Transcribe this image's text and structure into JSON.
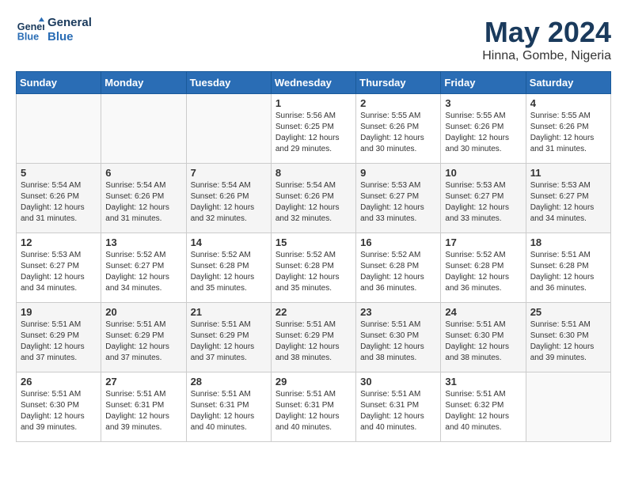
{
  "header": {
    "logo_line1": "General",
    "logo_line2": "Blue",
    "month": "May 2024",
    "location": "Hinna, Gombe, Nigeria"
  },
  "weekdays": [
    "Sunday",
    "Monday",
    "Tuesday",
    "Wednesday",
    "Thursday",
    "Friday",
    "Saturday"
  ],
  "weeks": [
    [
      {
        "day": "",
        "info": ""
      },
      {
        "day": "",
        "info": ""
      },
      {
        "day": "",
        "info": ""
      },
      {
        "day": "1",
        "info": "Sunrise: 5:56 AM\nSunset: 6:25 PM\nDaylight: 12 hours and 29 minutes."
      },
      {
        "day": "2",
        "info": "Sunrise: 5:55 AM\nSunset: 6:26 PM\nDaylight: 12 hours and 30 minutes."
      },
      {
        "day": "3",
        "info": "Sunrise: 5:55 AM\nSunset: 6:26 PM\nDaylight: 12 hours and 30 minutes."
      },
      {
        "day": "4",
        "info": "Sunrise: 5:55 AM\nSunset: 6:26 PM\nDaylight: 12 hours and 31 minutes."
      }
    ],
    [
      {
        "day": "5",
        "info": "Sunrise: 5:54 AM\nSunset: 6:26 PM\nDaylight: 12 hours and 31 minutes."
      },
      {
        "day": "6",
        "info": "Sunrise: 5:54 AM\nSunset: 6:26 PM\nDaylight: 12 hours and 31 minutes."
      },
      {
        "day": "7",
        "info": "Sunrise: 5:54 AM\nSunset: 6:26 PM\nDaylight: 12 hours and 32 minutes."
      },
      {
        "day": "8",
        "info": "Sunrise: 5:54 AM\nSunset: 6:26 PM\nDaylight: 12 hours and 32 minutes."
      },
      {
        "day": "9",
        "info": "Sunrise: 5:53 AM\nSunset: 6:27 PM\nDaylight: 12 hours and 33 minutes."
      },
      {
        "day": "10",
        "info": "Sunrise: 5:53 AM\nSunset: 6:27 PM\nDaylight: 12 hours and 33 minutes."
      },
      {
        "day": "11",
        "info": "Sunrise: 5:53 AM\nSunset: 6:27 PM\nDaylight: 12 hours and 34 minutes."
      }
    ],
    [
      {
        "day": "12",
        "info": "Sunrise: 5:53 AM\nSunset: 6:27 PM\nDaylight: 12 hours and 34 minutes."
      },
      {
        "day": "13",
        "info": "Sunrise: 5:52 AM\nSunset: 6:27 PM\nDaylight: 12 hours and 34 minutes."
      },
      {
        "day": "14",
        "info": "Sunrise: 5:52 AM\nSunset: 6:28 PM\nDaylight: 12 hours and 35 minutes."
      },
      {
        "day": "15",
        "info": "Sunrise: 5:52 AM\nSunset: 6:28 PM\nDaylight: 12 hours and 35 minutes."
      },
      {
        "day": "16",
        "info": "Sunrise: 5:52 AM\nSunset: 6:28 PM\nDaylight: 12 hours and 36 minutes."
      },
      {
        "day": "17",
        "info": "Sunrise: 5:52 AM\nSunset: 6:28 PM\nDaylight: 12 hours and 36 minutes."
      },
      {
        "day": "18",
        "info": "Sunrise: 5:51 AM\nSunset: 6:28 PM\nDaylight: 12 hours and 36 minutes."
      }
    ],
    [
      {
        "day": "19",
        "info": "Sunrise: 5:51 AM\nSunset: 6:29 PM\nDaylight: 12 hours and 37 minutes."
      },
      {
        "day": "20",
        "info": "Sunrise: 5:51 AM\nSunset: 6:29 PM\nDaylight: 12 hours and 37 minutes."
      },
      {
        "day": "21",
        "info": "Sunrise: 5:51 AM\nSunset: 6:29 PM\nDaylight: 12 hours and 37 minutes."
      },
      {
        "day": "22",
        "info": "Sunrise: 5:51 AM\nSunset: 6:29 PM\nDaylight: 12 hours and 38 minutes."
      },
      {
        "day": "23",
        "info": "Sunrise: 5:51 AM\nSunset: 6:30 PM\nDaylight: 12 hours and 38 minutes."
      },
      {
        "day": "24",
        "info": "Sunrise: 5:51 AM\nSunset: 6:30 PM\nDaylight: 12 hours and 38 minutes."
      },
      {
        "day": "25",
        "info": "Sunrise: 5:51 AM\nSunset: 6:30 PM\nDaylight: 12 hours and 39 minutes."
      }
    ],
    [
      {
        "day": "26",
        "info": "Sunrise: 5:51 AM\nSunset: 6:30 PM\nDaylight: 12 hours and 39 minutes."
      },
      {
        "day": "27",
        "info": "Sunrise: 5:51 AM\nSunset: 6:31 PM\nDaylight: 12 hours and 39 minutes."
      },
      {
        "day": "28",
        "info": "Sunrise: 5:51 AM\nSunset: 6:31 PM\nDaylight: 12 hours and 40 minutes."
      },
      {
        "day": "29",
        "info": "Sunrise: 5:51 AM\nSunset: 6:31 PM\nDaylight: 12 hours and 40 minutes."
      },
      {
        "day": "30",
        "info": "Sunrise: 5:51 AM\nSunset: 6:31 PM\nDaylight: 12 hours and 40 minutes."
      },
      {
        "day": "31",
        "info": "Sunrise: 5:51 AM\nSunset: 6:32 PM\nDaylight: 12 hours and 40 minutes."
      },
      {
        "day": "",
        "info": ""
      }
    ]
  ]
}
